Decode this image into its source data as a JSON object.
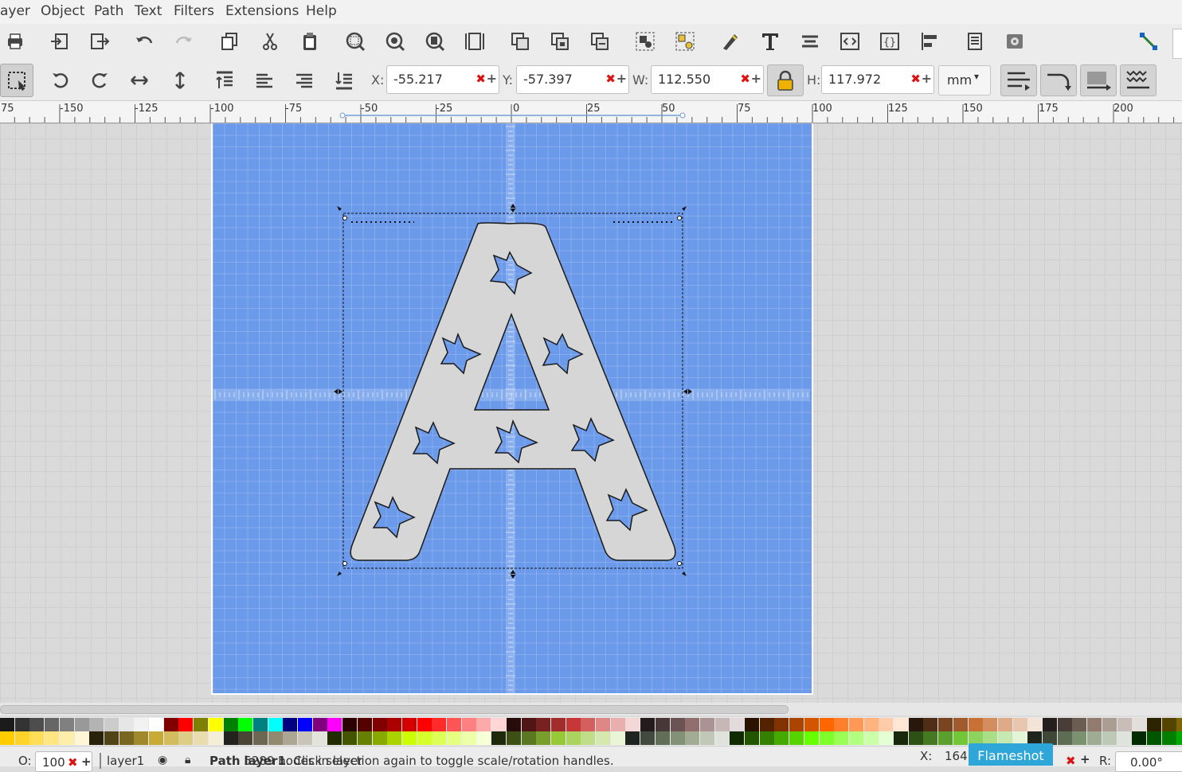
{
  "menu": {
    "items": [
      "ayer",
      "Object",
      "Path",
      "Text",
      "Filters",
      "Extensions",
      "Help"
    ]
  },
  "toolbar": {
    "icons": [
      "print-icon",
      "import-icon",
      "export-icon",
      "undo-icon",
      "redo-icon",
      "duplicate-icon",
      "cut-icon",
      "paste-icon",
      "zoom-selection-icon",
      "zoom-drawing-icon",
      "zoom-page-icon",
      "zoom-page-width-icon",
      "duplicate-object-icon",
      "clone-icon",
      "unlink-clone-icon",
      "group-icon",
      "ungroup-icon",
      "xml-editor-icon",
      "text-font-icon",
      "align-distribute-icon",
      "xml-icon",
      "object-properties-icon",
      "align-icon",
      "document-properties-icon",
      "preferences-icon",
      "snap-icon"
    ]
  },
  "selector": {
    "x_label": "X:",
    "x_value": "-55.217",
    "y_label": "Y:",
    "y_value": "-57.397",
    "w_label": "W:",
    "w_value": "112.550",
    "h_label": "H:",
    "h_value": "117.972",
    "unit": "mm"
  },
  "ruler": {
    "labels": [
      "75",
      "-150",
      "-125",
      "-100",
      "-75",
      "-50",
      "-25",
      "0",
      "25",
      "50",
      "75",
      "100",
      "125",
      "150",
      "175",
      "200"
    ]
  },
  "colors": {
    "page": "#6b9aea",
    "shape": "#d6d6d6",
    "accent": "#2fa6d8"
  },
  "statusbar": {
    "opacity_label": "O:",
    "opacity_value": "100",
    "layer": "layer1",
    "message_bold": "Path",
    "message": "5289 nodes in layer",
    "message_layer": "layer1",
    "message_tail": ". Click selection again to toggle scale/rotation handles.",
    "cursor_x_label": "X:",
    "cursor_x_value": "164",
    "rotation_label": "R:",
    "rotation_value": "0.00°"
  },
  "flameshot": {
    "label": "Flameshot"
  }
}
